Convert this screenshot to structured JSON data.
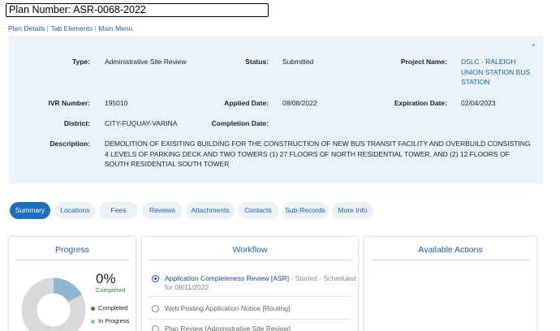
{
  "plan_number": "Plan Number: ASR-0068-2022",
  "nav": {
    "plan_details": "Plan Details",
    "tab_elements": "Tab Elements",
    "main_menu": "Main Menu"
  },
  "details": {
    "type_label": "Type:",
    "type_value": "Administrative Site Review",
    "status_label": "Status:",
    "status_value": "Submitted",
    "project_name_label": "Project Name:",
    "project_name_value": "DSLC - RALEIGH UNION STATION BUS STATION",
    "ivr_label": "IVR Number:",
    "ivr_value": "195010",
    "applied_label": "Applied Date:",
    "applied_value": "08/08/2022",
    "expiration_label": "Expiration Date:",
    "expiration_value": "02/04/2023",
    "district_label": "District:",
    "district_value": "CITY-FUQUAY-VARINA",
    "completion_label": "Completion Date:",
    "completion_value": "",
    "description_label": "Description:",
    "description_value": "DEMOLITION OF EXISITING BUILDING FOR THE CONSTRUCTION OF NEW BUS TRANSIT FACILITY AND OVERBUILD CONSISTING 4 LEVELS OF PARKING DECK AND TWO TOWERS (1) 27 FLOORS OF NORTH RESIDENTIAL TOWER, AND (2) 12 FLOORS OF SOUTH RESIDENTIAL SOUTH TOWER"
  },
  "tabs": [
    "Summary",
    "Locations",
    "Fees",
    "Reviews",
    "Attachments",
    "Contacts",
    "Sub-Records",
    "More Info"
  ],
  "active_tab": "Summary",
  "progress": {
    "title": "Progress",
    "percent_text": "0%",
    "percent_label": "Completed",
    "completed_fraction": 0,
    "in_progress_fraction": 0.17,
    "legend_completed": "Completed",
    "legend_in_progress": "In Progress",
    "colors": {
      "completed": "#2e8b3a",
      "in_progress": "#8fb5d3",
      "remaining": "#d9d9d9"
    }
  },
  "workflow": {
    "title": "Workflow",
    "items": [
      {
        "name": "Application Completeness Review [ASR]",
        "status": " - Started - Scheduled for 08/11/2022",
        "active": true
      },
      {
        "name": "Web Posting Application Notice [Routing]",
        "status": "",
        "active": false
      },
      {
        "name": "Plan Review [Administrative Site Review]",
        "status": "",
        "active": false
      }
    ]
  },
  "available_actions": {
    "title": "Available Actions"
  }
}
